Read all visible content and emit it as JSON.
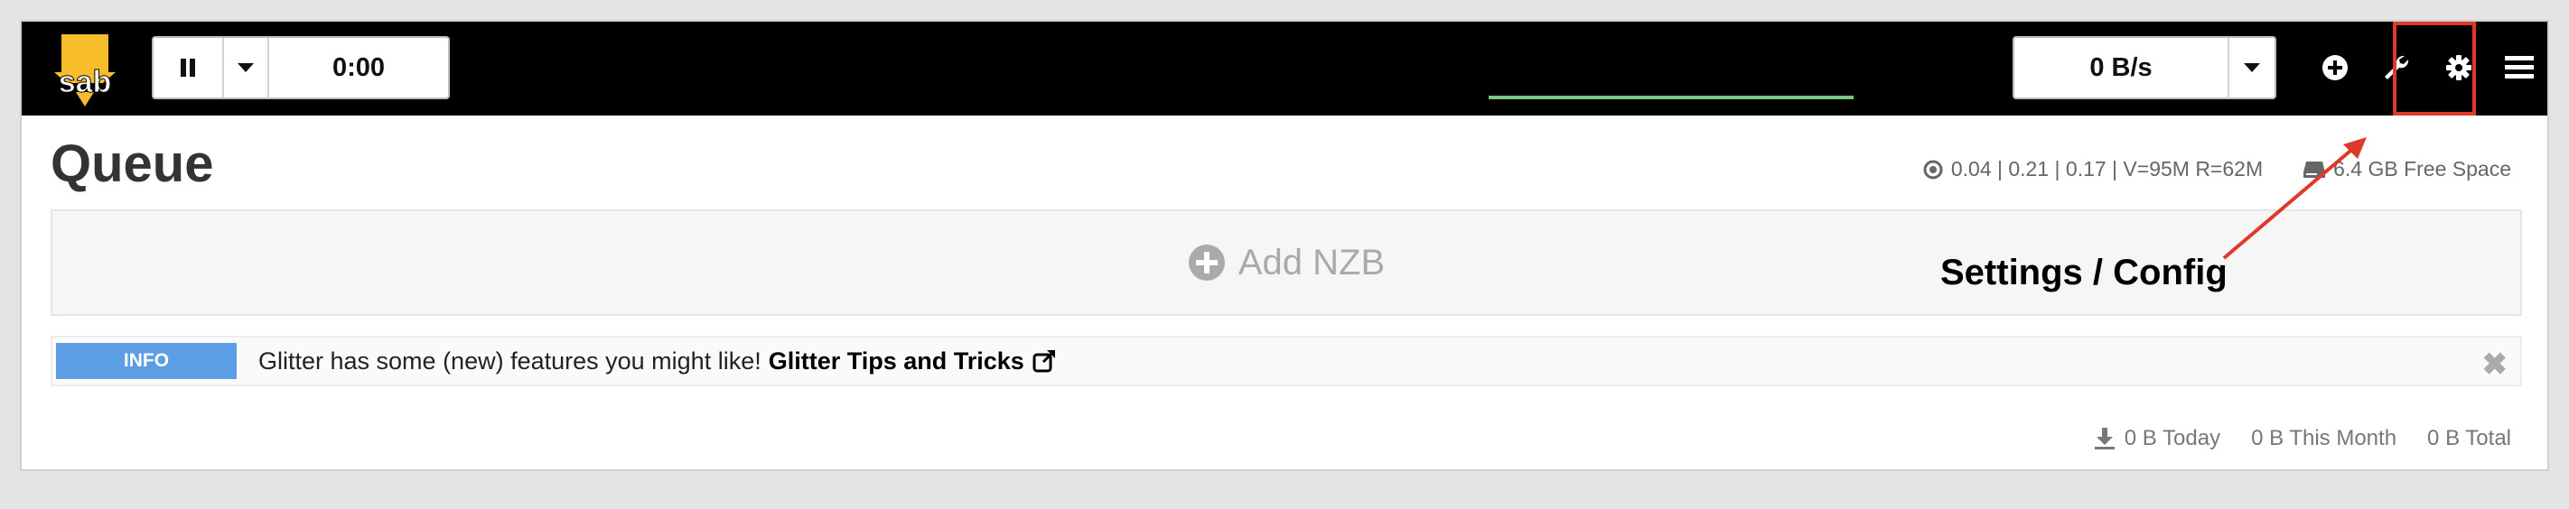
{
  "navbar": {
    "pause_label": "",
    "time": "0:00",
    "speed": "0 B/s",
    "icons": [
      "add-icon",
      "wrench-icon",
      "gear-icon",
      "menu-icon"
    ]
  },
  "header": {
    "title": "Queue",
    "load_stats": "0.04 | 0.21 | 0.17 | V=95M R=62M",
    "free_space": "6.4 GB Free Space"
  },
  "add_nzb": {
    "label": "Add NZB"
  },
  "annotation": {
    "label": "Settings / Config",
    "color": "#e0392b"
  },
  "info": {
    "badge": "INFO",
    "message": "Glitter has some (new) features you might like!",
    "link": "Glitter Tips and Tricks",
    "close": "✖"
  },
  "footer": {
    "today": "0 B Today",
    "month": "0 B This Month",
    "total": "0 B Total"
  },
  "colors": {
    "navbar_bg": "#000000",
    "info_badge": "#5b9ee6",
    "progress": "#7bc77b",
    "logo": "#f7bd2a"
  }
}
